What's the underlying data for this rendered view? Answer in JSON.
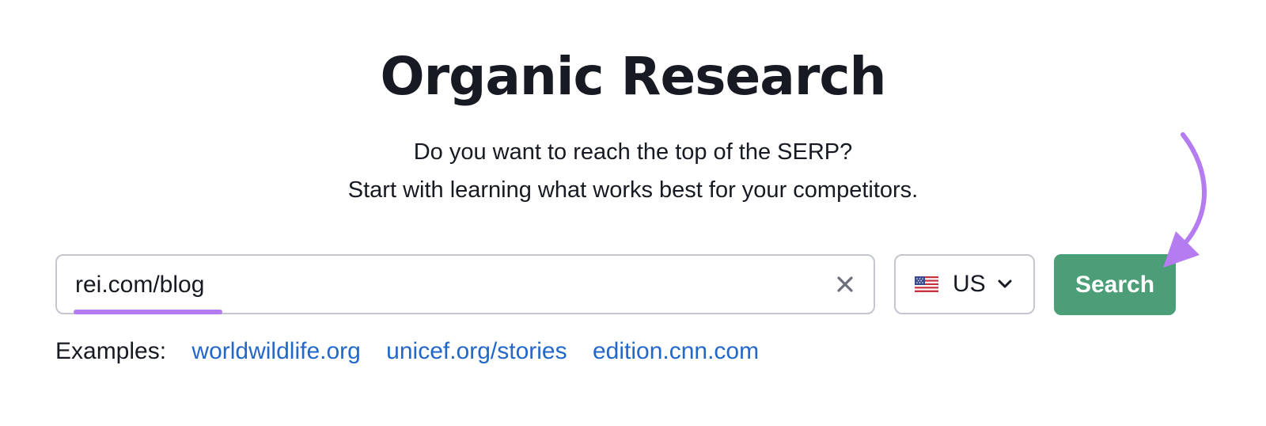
{
  "page": {
    "title": "Organic Research",
    "subtitle_line1": "Do you want to reach the top of the SERP?",
    "subtitle_line2": "Start with learning what works best for your competitors."
  },
  "search": {
    "value": "rei.com/blog",
    "clear_icon": "close-icon",
    "database": "US",
    "database_flag": "us-flag-icon",
    "button_label": "Search"
  },
  "examples": {
    "label": "Examples:",
    "links": [
      "worldwildlife.org",
      "unicef.org/stories",
      "edition.cnn.com"
    ]
  },
  "colors": {
    "button_bg": "#4c9e79",
    "link": "#2367c8",
    "annotation": "#b57cf2",
    "border": "#c4c7cf"
  }
}
